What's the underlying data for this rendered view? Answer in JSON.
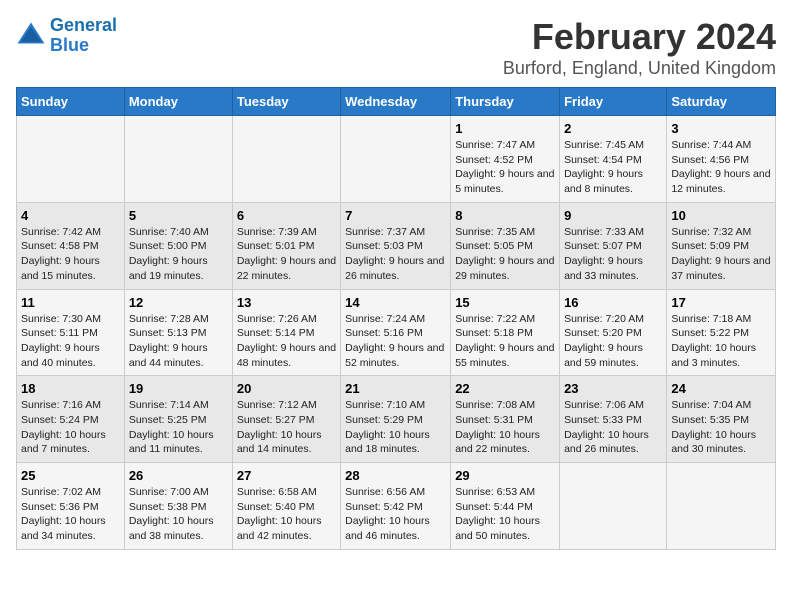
{
  "header": {
    "logo_line1": "General",
    "logo_line2": "Blue",
    "title": "February 2024",
    "subtitle": "Burford, England, United Kingdom"
  },
  "weekdays": [
    "Sunday",
    "Monday",
    "Tuesday",
    "Wednesday",
    "Thursday",
    "Friday",
    "Saturday"
  ],
  "weeks": [
    [
      {
        "day": "",
        "content": ""
      },
      {
        "day": "",
        "content": ""
      },
      {
        "day": "",
        "content": ""
      },
      {
        "day": "",
        "content": ""
      },
      {
        "day": "1",
        "content": "Sunrise: 7:47 AM\nSunset: 4:52 PM\nDaylight: 9 hours\nand 5 minutes."
      },
      {
        "day": "2",
        "content": "Sunrise: 7:45 AM\nSunset: 4:54 PM\nDaylight: 9 hours\nand 8 minutes."
      },
      {
        "day": "3",
        "content": "Sunrise: 7:44 AM\nSunset: 4:56 PM\nDaylight: 9 hours\nand 12 minutes."
      }
    ],
    [
      {
        "day": "4",
        "content": "Sunrise: 7:42 AM\nSunset: 4:58 PM\nDaylight: 9 hours\nand 15 minutes."
      },
      {
        "day": "5",
        "content": "Sunrise: 7:40 AM\nSunset: 5:00 PM\nDaylight: 9 hours\nand 19 minutes."
      },
      {
        "day": "6",
        "content": "Sunrise: 7:39 AM\nSunset: 5:01 PM\nDaylight: 9 hours\nand 22 minutes."
      },
      {
        "day": "7",
        "content": "Sunrise: 7:37 AM\nSunset: 5:03 PM\nDaylight: 9 hours\nand 26 minutes."
      },
      {
        "day": "8",
        "content": "Sunrise: 7:35 AM\nSunset: 5:05 PM\nDaylight: 9 hours\nand 29 minutes."
      },
      {
        "day": "9",
        "content": "Sunrise: 7:33 AM\nSunset: 5:07 PM\nDaylight: 9 hours\nand 33 minutes."
      },
      {
        "day": "10",
        "content": "Sunrise: 7:32 AM\nSunset: 5:09 PM\nDaylight: 9 hours\nand 37 minutes."
      }
    ],
    [
      {
        "day": "11",
        "content": "Sunrise: 7:30 AM\nSunset: 5:11 PM\nDaylight: 9 hours\nand 40 minutes."
      },
      {
        "day": "12",
        "content": "Sunrise: 7:28 AM\nSunset: 5:13 PM\nDaylight: 9 hours\nand 44 minutes."
      },
      {
        "day": "13",
        "content": "Sunrise: 7:26 AM\nSunset: 5:14 PM\nDaylight: 9 hours\nand 48 minutes."
      },
      {
        "day": "14",
        "content": "Sunrise: 7:24 AM\nSunset: 5:16 PM\nDaylight: 9 hours\nand 52 minutes."
      },
      {
        "day": "15",
        "content": "Sunrise: 7:22 AM\nSunset: 5:18 PM\nDaylight: 9 hours\nand 55 minutes."
      },
      {
        "day": "16",
        "content": "Sunrise: 7:20 AM\nSunset: 5:20 PM\nDaylight: 9 hours\nand 59 minutes."
      },
      {
        "day": "17",
        "content": "Sunrise: 7:18 AM\nSunset: 5:22 PM\nDaylight: 10 hours\nand 3 minutes."
      }
    ],
    [
      {
        "day": "18",
        "content": "Sunrise: 7:16 AM\nSunset: 5:24 PM\nDaylight: 10 hours\nand 7 minutes."
      },
      {
        "day": "19",
        "content": "Sunrise: 7:14 AM\nSunset: 5:25 PM\nDaylight: 10 hours\nand 11 minutes."
      },
      {
        "day": "20",
        "content": "Sunrise: 7:12 AM\nSunset: 5:27 PM\nDaylight: 10 hours\nand 14 minutes."
      },
      {
        "day": "21",
        "content": "Sunrise: 7:10 AM\nSunset: 5:29 PM\nDaylight: 10 hours\nand 18 minutes."
      },
      {
        "day": "22",
        "content": "Sunrise: 7:08 AM\nSunset: 5:31 PM\nDaylight: 10 hours\nand 22 minutes."
      },
      {
        "day": "23",
        "content": "Sunrise: 7:06 AM\nSunset: 5:33 PM\nDaylight: 10 hours\nand 26 minutes."
      },
      {
        "day": "24",
        "content": "Sunrise: 7:04 AM\nSunset: 5:35 PM\nDaylight: 10 hours\nand 30 minutes."
      }
    ],
    [
      {
        "day": "25",
        "content": "Sunrise: 7:02 AM\nSunset: 5:36 PM\nDaylight: 10 hours\nand 34 minutes."
      },
      {
        "day": "26",
        "content": "Sunrise: 7:00 AM\nSunset: 5:38 PM\nDaylight: 10 hours\nand 38 minutes."
      },
      {
        "day": "27",
        "content": "Sunrise: 6:58 AM\nSunset: 5:40 PM\nDaylight: 10 hours\nand 42 minutes."
      },
      {
        "day": "28",
        "content": "Sunrise: 6:56 AM\nSunset: 5:42 PM\nDaylight: 10 hours\nand 46 minutes."
      },
      {
        "day": "29",
        "content": "Sunrise: 6:53 AM\nSunset: 5:44 PM\nDaylight: 10 hours\nand 50 minutes."
      },
      {
        "day": "",
        "content": ""
      },
      {
        "day": "",
        "content": ""
      }
    ]
  ]
}
